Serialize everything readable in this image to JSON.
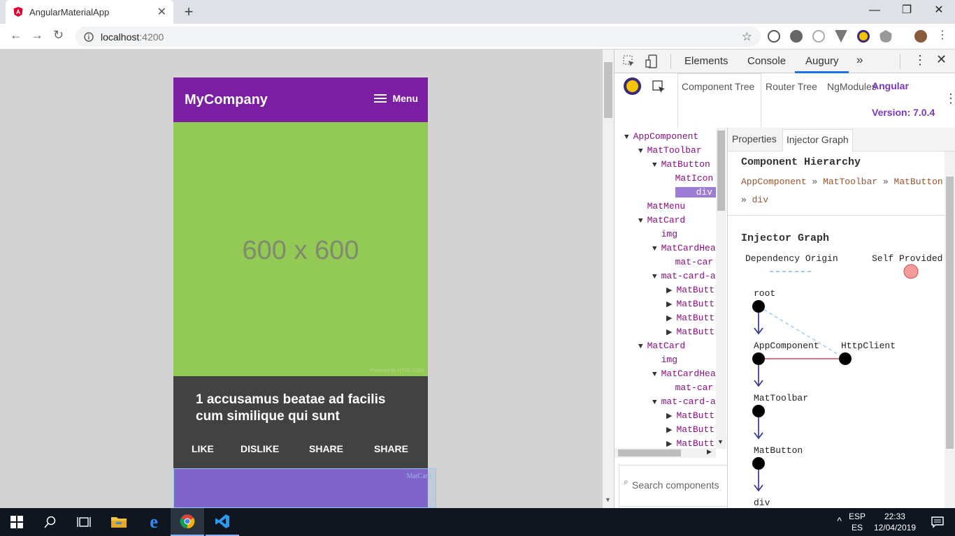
{
  "browser": {
    "tab_title": "AngularMaterialApp",
    "tab_close": "✕",
    "new_tab": "+",
    "url_host": "localhost",
    "url_port": ":4200",
    "window_controls": [
      "—",
      "❐",
      "✕"
    ]
  },
  "app": {
    "brand": "MyCompany",
    "menu_label": "Menu",
    "placeholder_text": "600 x 600",
    "placeholder_credit": "Powered by HTML.COM",
    "card_title": "1 accusamus beatae ad facilis cum similique qui sunt",
    "actions": [
      "LIKE",
      "DISLIKE",
      "SHARE",
      "SHARE"
    ],
    "highlight_tag": "MatCard"
  },
  "devtools": {
    "tabs": [
      "Elements",
      "Console",
      "Augury"
    ],
    "more": "»",
    "augury_tabs": [
      "Component Tree",
      "Router Tree",
      "NgModules"
    ],
    "brand": "Angular",
    "version": "Version: 7.0.4",
    "tree": [
      {
        "label": "AppComponent",
        "indent": 0,
        "arrow": "▼"
      },
      {
        "label": "MatToolbar",
        "indent": 1,
        "arrow": "▼"
      },
      {
        "label": "MatButton",
        "indent": 2,
        "arrow": "▼"
      },
      {
        "label": "MatIcon",
        "indent": 3,
        "arrow": ""
      },
      {
        "label": "div",
        "indent": 3,
        "arrow": "",
        "selected": true
      },
      {
        "label": "MatMenu",
        "indent": 1,
        "arrow": ""
      },
      {
        "label": "MatCard",
        "indent": 1,
        "arrow": "▼"
      },
      {
        "label": "img",
        "indent": 2,
        "arrow": ""
      },
      {
        "label": "MatCardHea",
        "indent": 2,
        "arrow": "▼"
      },
      {
        "label": "mat-car",
        "indent": 3,
        "arrow": ""
      },
      {
        "label": "mat-card-a",
        "indent": 2,
        "arrow": "▼"
      },
      {
        "label": "MatButt",
        "indent": 3,
        "arrow": "▶"
      },
      {
        "label": "MatButt",
        "indent": 3,
        "arrow": "▶"
      },
      {
        "label": "MatButt",
        "indent": 3,
        "arrow": "▶"
      },
      {
        "label": "MatButt",
        "indent": 3,
        "arrow": "▶"
      },
      {
        "label": "MatCard",
        "indent": 1,
        "arrow": "▼"
      },
      {
        "label": "img",
        "indent": 2,
        "arrow": ""
      },
      {
        "label": "MatCardHea",
        "indent": 2,
        "arrow": "▼"
      },
      {
        "label": "mat-car",
        "indent": 3,
        "arrow": ""
      },
      {
        "label": "mat-card-a",
        "indent": 2,
        "arrow": "▼"
      },
      {
        "label": "MatButt",
        "indent": 3,
        "arrow": "▶"
      },
      {
        "label": "MatButt",
        "indent": 3,
        "arrow": "▶"
      },
      {
        "label": "MatButt",
        "indent": 3,
        "arrow": "▶"
      }
    ],
    "search_placeholder": "Search components",
    "subtabs": [
      "Properties",
      "Injector Graph"
    ],
    "hierarchy_title": "Component Hierarchy",
    "breadcrumb": [
      "AppComponent",
      "MatToolbar",
      "MatButton",
      "div"
    ],
    "breadcrumb_sep": "»",
    "injector_title": "Injector Graph",
    "legend_dependency": "Dependency Origin",
    "legend_self": "Self Provided",
    "graph_nodes": [
      "root",
      "AppComponent",
      "HttpClient",
      "MatToolbar",
      "MatButton",
      "div"
    ]
  },
  "taskbar": {
    "lang_top": "ESP",
    "lang_bottom": "ES",
    "time": "22:33",
    "date": "12/04/2019"
  },
  "colors": {
    "toolbar_purple": "#7b1fa2",
    "placeholder_green": "#93c955",
    "card_dark": "#424242",
    "augury_purple": "#7c38bd",
    "tree_purple": "#881280"
  }
}
